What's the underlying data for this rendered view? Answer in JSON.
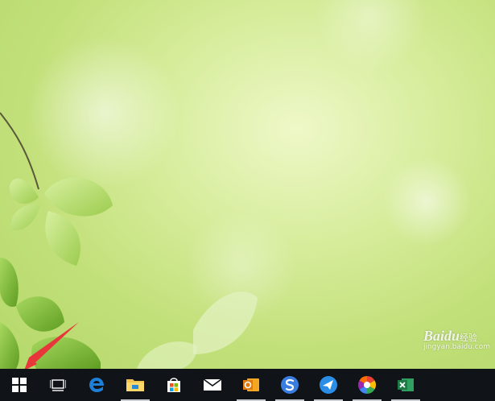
{
  "watermark": {
    "brand": "Baidu",
    "suffix": "经验",
    "site": "jingyan.baidu.com"
  },
  "taskbar": {
    "items": [
      {
        "icon": "windows-start-icon",
        "open": false
      },
      {
        "icon": "task-view-icon",
        "open": false
      },
      {
        "icon": "edge-browser-icon",
        "open": false
      },
      {
        "icon": "file-explorer-icon",
        "open": true
      },
      {
        "icon": "store-icon",
        "open": false
      },
      {
        "icon": "mail-icon",
        "open": false
      },
      {
        "icon": "outlook-icon",
        "open": true
      },
      {
        "icon": "sogou-icon",
        "open": true
      },
      {
        "icon": "feishu-bird-icon",
        "open": true
      },
      {
        "icon": "color-wheel-app-icon",
        "open": true
      },
      {
        "icon": "excel-icon",
        "open": true
      }
    ]
  },
  "colors": {
    "taskbar": "#101418",
    "accent_edge": "#1e7fd6",
    "arrow": "#e8373a"
  }
}
